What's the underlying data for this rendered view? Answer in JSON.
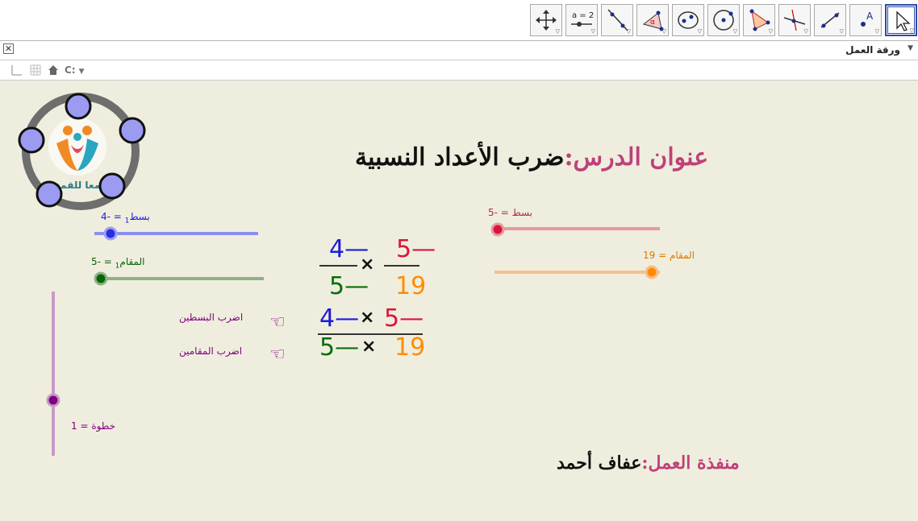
{
  "toolbar": {
    "tools": [
      {
        "name": "move-graphics-view-tool",
        "icon": "move-arrows-icon"
      },
      {
        "name": "slider-tool",
        "icon": "slider-icon",
        "label": "a = 2"
      },
      {
        "name": "line-through-points-tool",
        "icon": "line-icon"
      },
      {
        "name": "angle-tool",
        "icon": "angle-icon",
        "label": "α"
      },
      {
        "name": "conic-tool",
        "icon": "ellipse-icon"
      },
      {
        "name": "circle-tool",
        "icon": "circle-icon"
      },
      {
        "name": "polygon-tool",
        "icon": "polygon-icon"
      },
      {
        "name": "perpendicular-line-tool",
        "icon": "perpendicular-icon"
      },
      {
        "name": "segment-tool",
        "icon": "segment-icon"
      },
      {
        "name": "point-tool",
        "icon": "point-icon",
        "label": "A"
      },
      {
        "name": "move-tool",
        "icon": "cursor-arrow-icon"
      }
    ]
  },
  "panel": {
    "title": "ورقة العمل",
    "close_label": "✕",
    "menu_label": "▼"
  },
  "stylebar": {
    "graph_label": "C:"
  },
  "lesson": {
    "heading_label": "عنوان الدرس:",
    "heading_value": "ضرب الأعداد النسبية",
    "author_label": "منفذة العمل:",
    "author_value": "عفاف أحمد",
    "logo_text": "معا للقمة"
  },
  "sliders": {
    "num1": {
      "label": "بسط",
      "sub": "1",
      "eq": " = -4",
      "value": -4,
      "color": "#8a8ff0",
      "knob": "#2d2ddc"
    },
    "den1": {
      "label": "المقام",
      "sub": "1",
      "eq": " = -5",
      "value": -5,
      "color": "#8fb187",
      "knob": "#0a640a"
    },
    "num2": {
      "label": "بسط = -5",
      "value": -5,
      "color": "#e59aa0",
      "knob": "#dc143c"
    },
    "den2": {
      "label": "المقام = 19",
      "value": 19,
      "color": "#f5c08c",
      "knob": "#ff8c00"
    },
    "step": {
      "label": "خطوة = 1",
      "value": 1,
      "color": "#c79ac7",
      "knob": "#800080"
    }
  },
  "fractions": {
    "f1_num": "4",
    "f1_den": "5",
    "f2_num": "5",
    "f2_den": "19",
    "times": "×",
    "minus": "—",
    "p_num1": "4",
    "p_num2": "5",
    "p_den1": "5",
    "p_den2": "19"
  },
  "steps": {
    "multiply_numerators": "اضرب البسطين",
    "multiply_denominators": "اضرب المقامين",
    "pointer": "☜"
  },
  "colors": {
    "blue": "#1c1cd6",
    "red": "#dc143c",
    "green": "#0a6e0a",
    "orange": "#ff8c00",
    "purple": "#800080",
    "magenta": "#c0407a"
  }
}
